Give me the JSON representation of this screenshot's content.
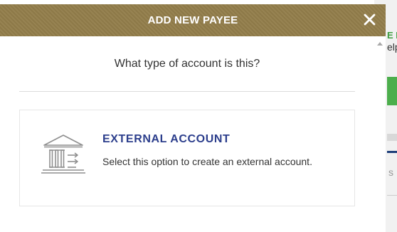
{
  "modal": {
    "title": "ADD NEW PAYEE",
    "close_icon": "close-icon",
    "question": "What type of account is this?",
    "options": [
      {
        "icon": "bank-transfer-icon",
        "title": "EXTERNAL ACCOUNT",
        "description": "Select this option to create an external account."
      }
    ]
  },
  "background": {
    "green_text": "E I",
    "dark_text": "elp",
    "gray_letter": "s"
  },
  "colors": {
    "header_bg": "#8d7948",
    "title_accent": "#2c3e8c",
    "background_green": "#4cae4c"
  }
}
